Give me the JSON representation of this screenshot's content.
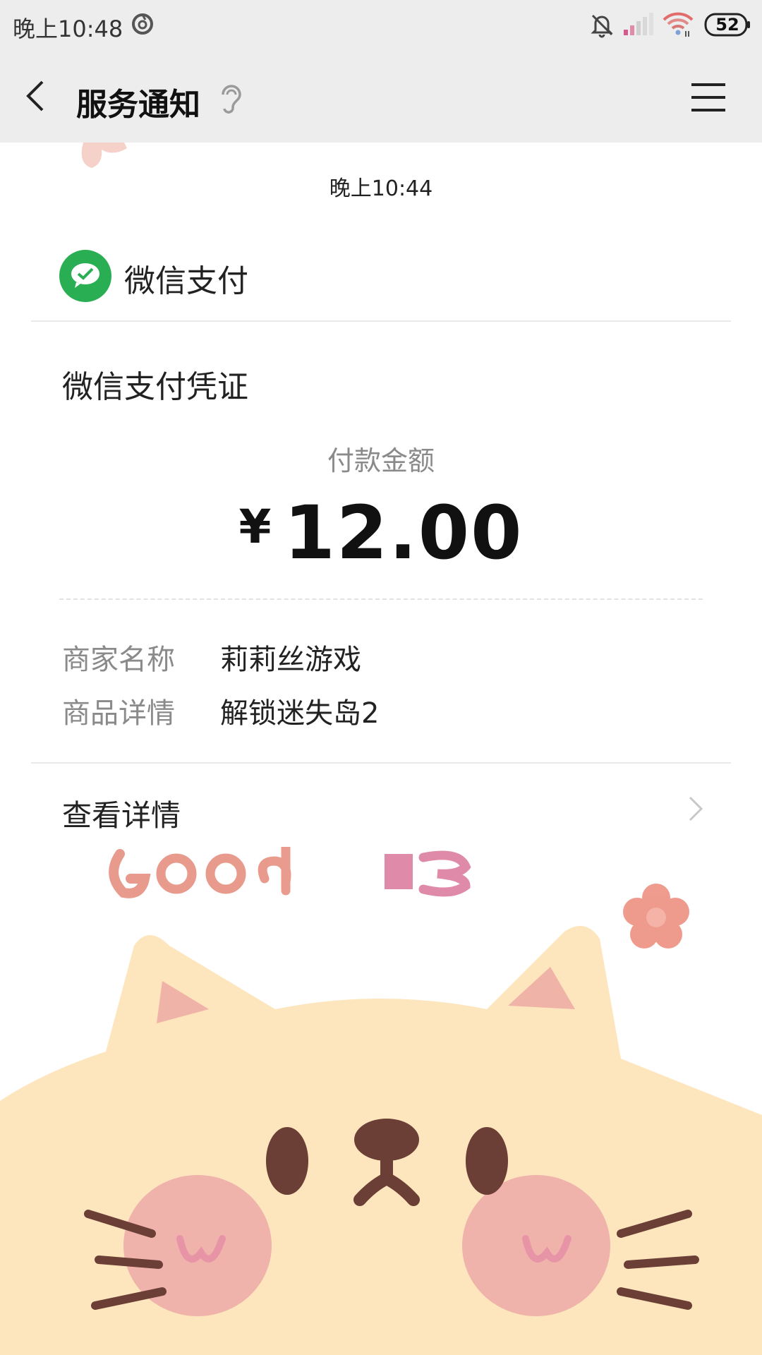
{
  "status_bar": {
    "time": "晚上10:48",
    "battery": "52",
    "icons": [
      "app-logo-icon",
      "mute-bell-icon",
      "signal-icon",
      "wifi-icon",
      "battery-icon"
    ]
  },
  "nav": {
    "title": "服务通知",
    "icons": [
      "back-icon",
      "ear-icon",
      "menu-icon"
    ]
  },
  "message": {
    "timestamp": "晚上10:44",
    "source": "微信支付",
    "title": "微信支付凭证",
    "amount_label": "付款金额",
    "currency": "¥",
    "amount": "12.00",
    "fields": [
      {
        "key": "商家名称",
        "value": "莉莉丝游戏"
      },
      {
        "key": "商品详情",
        "value": "解锁迷失岛2"
      }
    ],
    "details_link": "查看详情"
  },
  "colors": {
    "wechat_green": "#2aae53",
    "background_bar": "#ededed",
    "cat_fill": "#fde6bd"
  }
}
